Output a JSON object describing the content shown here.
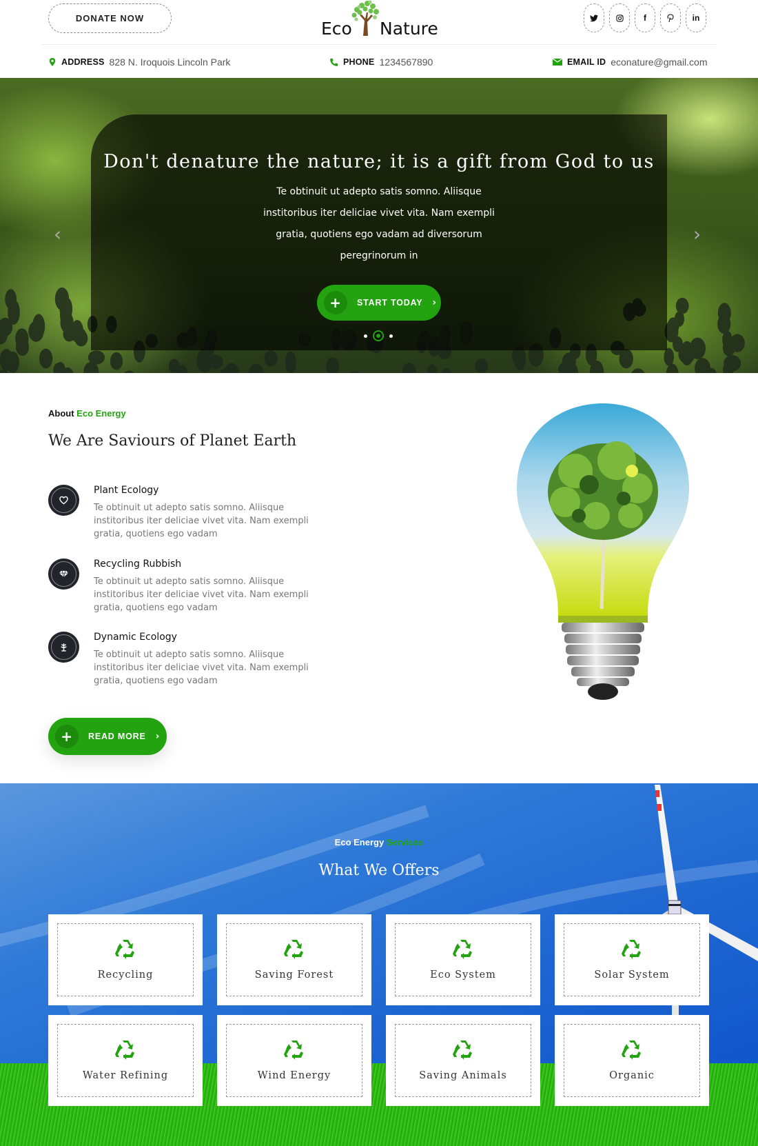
{
  "header": {
    "donate_label": "DONATE NOW",
    "logo": {
      "left": "Eco",
      "right": "Nature"
    },
    "socials": [
      {
        "name": "twitter",
        "glyph": "🐦"
      },
      {
        "name": "instagram",
        "glyph": "◎"
      },
      {
        "name": "facebook",
        "glyph": "f"
      },
      {
        "name": "pinterest",
        "glyph": "℘"
      },
      {
        "name": "linkedin",
        "glyph": "in"
      }
    ],
    "contact": {
      "address": {
        "label": "ADDRESS",
        "value": "828 N. Iroquois Lincoln Park"
      },
      "phone": {
        "label": "PHONE",
        "value": "1234567890"
      },
      "email": {
        "label": "EMAIL ID",
        "value": "econature@gmail.com"
      }
    }
  },
  "hero": {
    "title": "Don't denature the nature; it is a gift from God to us",
    "text": "Te obtinuit ut adepto satis somno. Aliisque institoribus iter deliciae vivet vita. Nam exempli gratia, quotiens ego vadam ad diversorum peregrinorum in",
    "button_label": "START TODAY",
    "button_plus": "+",
    "button_chevron": "›",
    "prev_arrow": "‹",
    "next_arrow": "›",
    "slides": 3,
    "active_slide": 2
  },
  "about": {
    "eyebrow_plain": "About",
    "eyebrow_accent": "Eco Energy",
    "title": "We Are Saviours of Planet Earth",
    "features": [
      {
        "title": "Plant Ecology",
        "text": "Te obtinuit ut adepto satis somno. Aliisque institoribus iter deliciae vivet vita. Nam exempli gratia, quotiens ego vadam",
        "icon": "heart-icon"
      },
      {
        "title": "Recycling Rubbish",
        "text": "Te obtinuit ut adepto satis somno. Aliisque institoribus iter deliciae vivet vita. Nam exempli gratia, quotiens ego vadam",
        "icon": "diamond-icon"
      },
      {
        "title": "Dynamic Ecology",
        "text": "Te obtinuit ut adepto satis somno. Aliisque institoribus iter deliciae vivet vita. Nam exempli gratia, quotiens ego vadam",
        "icon": "leaf-icon"
      }
    ],
    "button_label": "READ MORE",
    "button_plus": "+",
    "button_chevron": "›"
  },
  "services": {
    "eyebrow_plain": "Eco Energy",
    "eyebrow_accent": "Services",
    "title": "What We Offers",
    "items": [
      {
        "label": "Recycling",
        "icon": "recycle-icon"
      },
      {
        "label": "Saving Forest",
        "icon": "recycle-icon"
      },
      {
        "label": "Eco System",
        "icon": "recycle-icon"
      },
      {
        "label": "Solar System",
        "icon": "recycle-icon"
      },
      {
        "label": "Water Refining",
        "icon": "recycle-icon"
      },
      {
        "label": "Wind Energy",
        "icon": "recycle-icon"
      },
      {
        "label": "Saving Animals",
        "icon": "recycle-icon"
      },
      {
        "label": "Organic",
        "icon": "recycle-icon"
      }
    ]
  },
  "colors": {
    "accent": "#22a30f",
    "dark_icon_bg": "#21252b",
    "sky": "#1d66d1"
  }
}
